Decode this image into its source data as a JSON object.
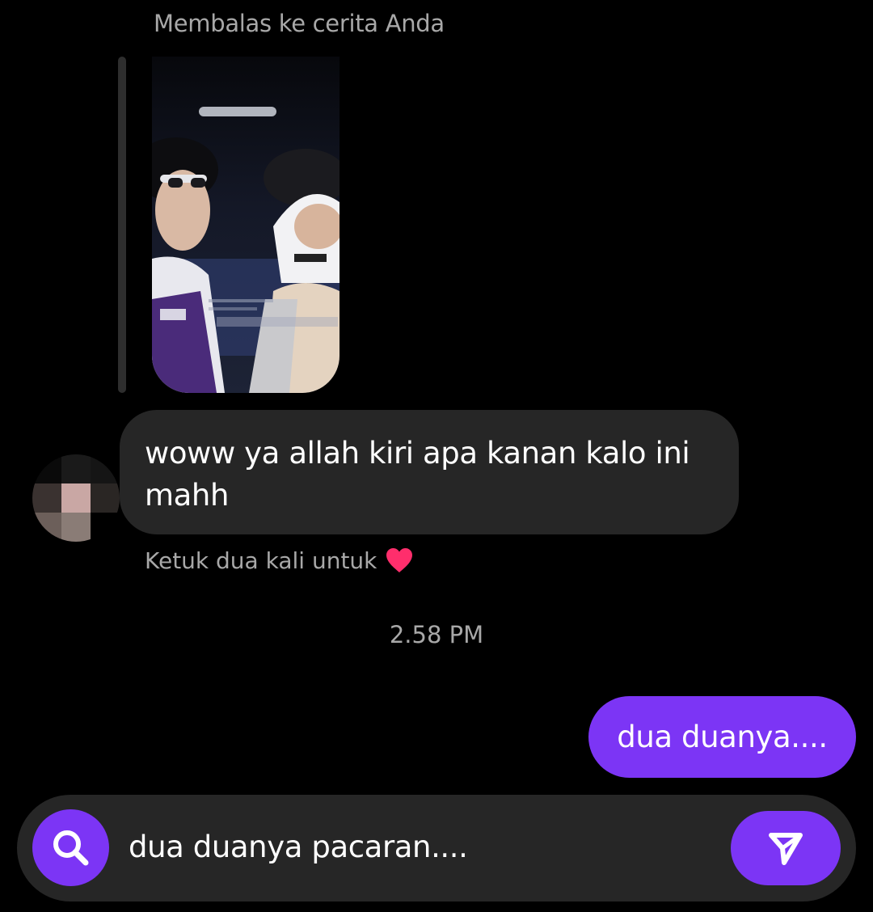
{
  "story_reply": {
    "header": "Membalas ke cerita Anda",
    "thumbnail_icon": "story-thumbnail-image"
  },
  "incoming_message": {
    "text": "woww ya allah kiri apa kanan kalo ini mahh",
    "double_tap_hint": "Ketuk dua kali untuk",
    "heart_icon": "heart-icon",
    "heart_color": "#ff2e6c"
  },
  "timestamp": "2.58 PM",
  "outgoing_message": {
    "text": "dua duanya...."
  },
  "composer": {
    "value": "dua duanya pacaran....",
    "search_icon": "search-icon",
    "send_icon": "send-icon"
  },
  "colors": {
    "background": "#000000",
    "bubble_incoming": "#262626",
    "accent": "#7c35f5",
    "muted_text": "#a8a8a8"
  }
}
